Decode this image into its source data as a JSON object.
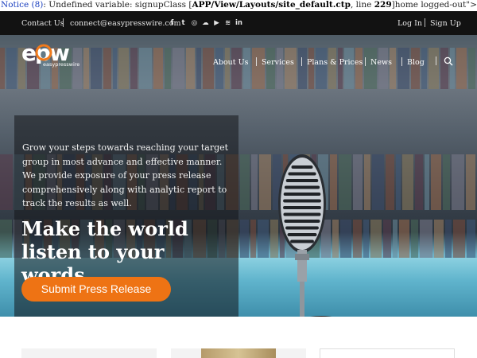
{
  "notice": {
    "label": "Notice",
    "code": "(8)",
    "message_prefix": ": Undefined variable: signupClass [",
    "path": "APP/View/Layouts/site_default.ctp",
    "line_label": ", line ",
    "line_number": "229",
    "message_suffix": "]home logged-out\">"
  },
  "topbar": {
    "contact_label": "Contact Us",
    "email": "connect@easypresswire.com",
    "social_icons": [
      "facebook-icon",
      "twitter-icon",
      "instagram-icon",
      "soundcloud-icon",
      "youtube-icon",
      "rss-icon",
      "linkedin-icon"
    ],
    "social_glyphs": [
      "f",
      "t",
      "◎",
      "☁",
      "▶",
      "≋",
      "in"
    ],
    "login_label": "Log In",
    "signup_label": "Sign Up"
  },
  "nav": {
    "logo_text": "epw",
    "logo_subtext": "easypresswire",
    "items": [
      "About Us",
      "Services",
      "Plans & Prices",
      "News",
      "Blog"
    ]
  },
  "hero": {
    "lead": "Grow your steps towards reaching your target group in most advance and effective manner. We provide exposure of your press release comprehensively along with analytic report to track the results as well.",
    "headline": "Make the world listen to your words.",
    "cta_label": "Submit Press Release"
  },
  "colors": {
    "accent": "#ee7314",
    "topbar": "#121212",
    "notice_link": "#1a3fbf"
  }
}
